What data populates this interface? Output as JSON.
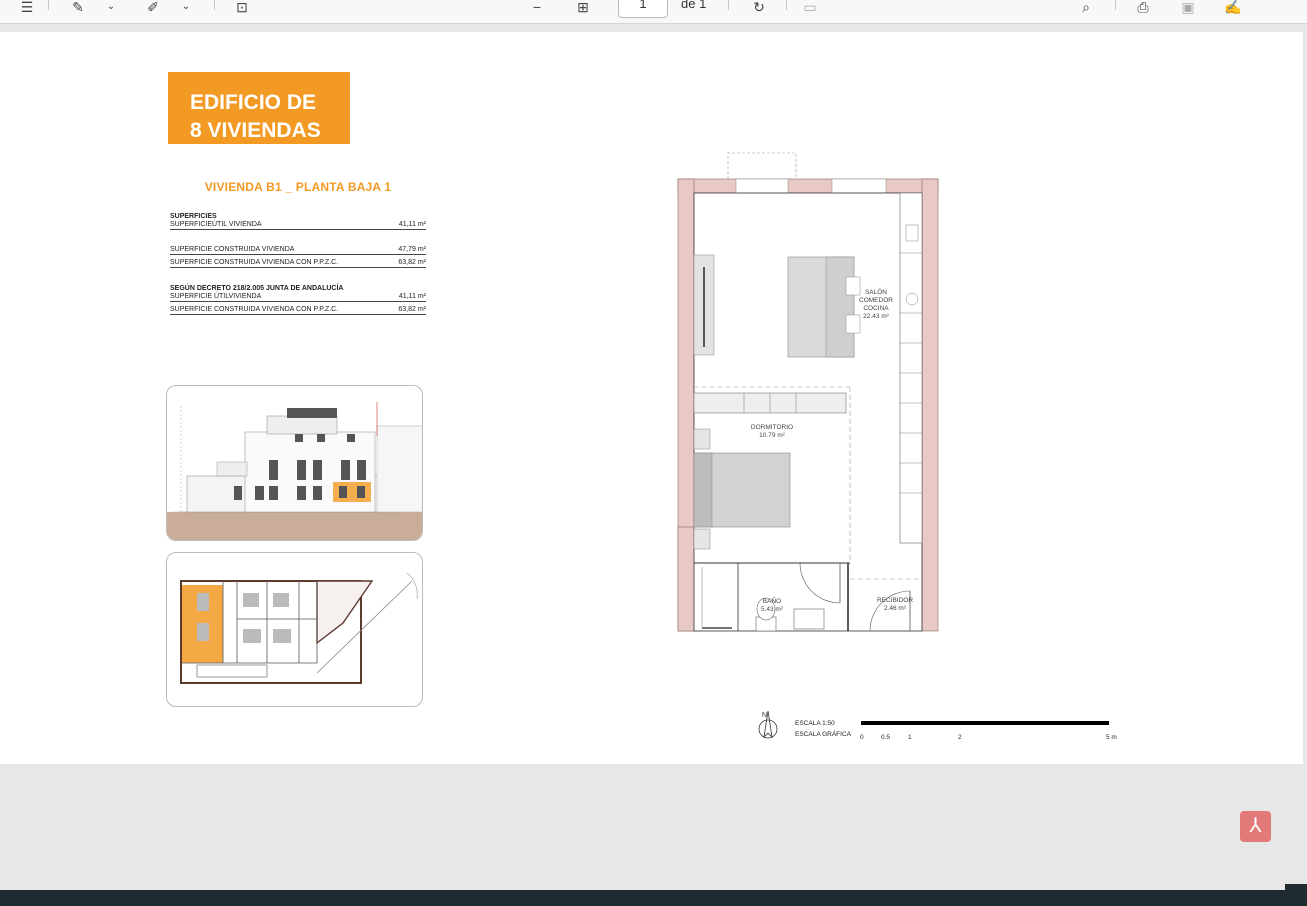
{
  "toolbar": {
    "page_current": "1",
    "page_of": "de 1"
  },
  "document": {
    "title_line1": "EDIFICIO DE",
    "title_line2": "8 VIVIENDAS",
    "subtitle": "VIVIENDA B1 _ PLANTA BAJA 1",
    "superficies": {
      "heading": "SUPERFICIES",
      "rows": [
        {
          "label": "SUPERFICIEÚTIL VIVIENDA",
          "value": "41,11 m²"
        },
        {
          "label": "SUPERFICIE CONSTRUIDA VIVIENDA",
          "value": "47,79 m²"
        },
        {
          "label": "SUPERFICIE CONSTRUIDA VIVIENDA CON P.P.Z.C.",
          "value": "63,82 m²"
        }
      ]
    },
    "decreto": {
      "heading": "SEGÚN DECRETO 218/2.005 JUNTA DE ANDALUCÍA",
      "rows": [
        {
          "label": "SUPERFICIE ÚTILVIVIENDA",
          "value": "41,11 m²"
        },
        {
          "label": "SUPERFICIE CONSTRUIDA VIVIENDA CON P.P.Z.C.",
          "value": "63,82 m²"
        }
      ]
    },
    "rooms": {
      "salon_l1": "SALÓN",
      "salon_l2": "COMEDOR",
      "salon_l3": "COCINA",
      "salon_area": "22.43 m²",
      "dormitorio": "DORMITORIO",
      "dormitorio_area": "10.79 m²",
      "bano": "BAÑO",
      "bano_area": "5.43 m²",
      "recibidor": "RECIBIDOR",
      "recibidor_area": "2.46 m²"
    },
    "scale": {
      "north": "N",
      "escala": "ESCALA 1:50",
      "escala_grafica": "ESCALA GRÁFICA",
      "ticks": [
        "0",
        "0.5",
        "1",
        "2",
        "5 m"
      ]
    }
  },
  "colors": {
    "accent": "#f39a24",
    "wall": "#e8c9c4",
    "pdf_badge": "#e27a7a"
  }
}
